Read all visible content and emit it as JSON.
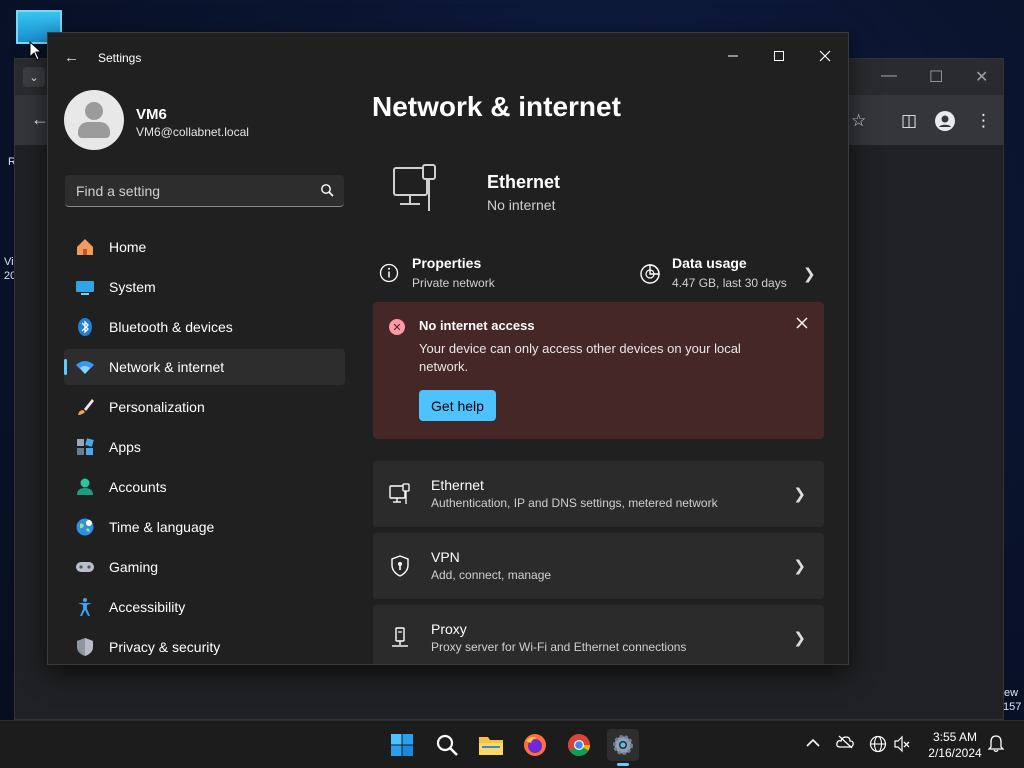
{
  "desktop": {
    "left_text_1": "R",
    "left_text_2": "Vi",
    "left_text_3": "20",
    "right_text_1": "ew",
    "right_text_2": "157"
  },
  "settings": {
    "title": "Settings",
    "profile": {
      "name": "VM6",
      "email": "VM6@collabnet.local"
    },
    "search": {
      "placeholder": "Find a setting"
    },
    "nav": [
      {
        "label": "Home",
        "icon": "home-icon"
      },
      {
        "label": "System",
        "icon": "system-icon"
      },
      {
        "label": "Bluetooth & devices",
        "icon": "bluetooth-icon"
      },
      {
        "label": "Network & internet",
        "icon": "wifi-icon",
        "active": true
      },
      {
        "label": "Personalization",
        "icon": "brush-icon"
      },
      {
        "label": "Apps",
        "icon": "apps-icon"
      },
      {
        "label": "Accounts",
        "icon": "accounts-icon"
      },
      {
        "label": "Time & language",
        "icon": "globe-icon"
      },
      {
        "label": "Gaming",
        "icon": "gamepad-icon"
      },
      {
        "label": "Accessibility",
        "icon": "accessibility-icon"
      },
      {
        "label": "Privacy & security",
        "icon": "shield-icon"
      }
    ],
    "page_title": "Network & internet",
    "hero": {
      "title": "Ethernet",
      "status": "No internet"
    },
    "properties": {
      "title": "Properties",
      "sub": "Private network"
    },
    "data_usage": {
      "title": "Data usage",
      "sub": "4.47 GB, last 30 days"
    },
    "alert": {
      "title": "No internet access",
      "text": "Your device can only access other devices on your local network.",
      "button": "Get help"
    },
    "cards": [
      {
        "title": "Ethernet",
        "sub": "Authentication, IP and DNS settings, metered network",
        "icon": "ethernet-icon"
      },
      {
        "title": "VPN",
        "sub": "Add, connect, manage",
        "icon": "vpn-shield-icon"
      },
      {
        "title": "Proxy",
        "sub": "Proxy server for Wi-Fi and Ethernet connections",
        "icon": "proxy-icon"
      }
    ]
  },
  "taskbar": {
    "time": "3:55 AM",
    "date": "2/16/2024"
  },
  "colors": {
    "accent": "#60cdff",
    "button": "#4cc2ff",
    "alert_bg": "#442726"
  }
}
